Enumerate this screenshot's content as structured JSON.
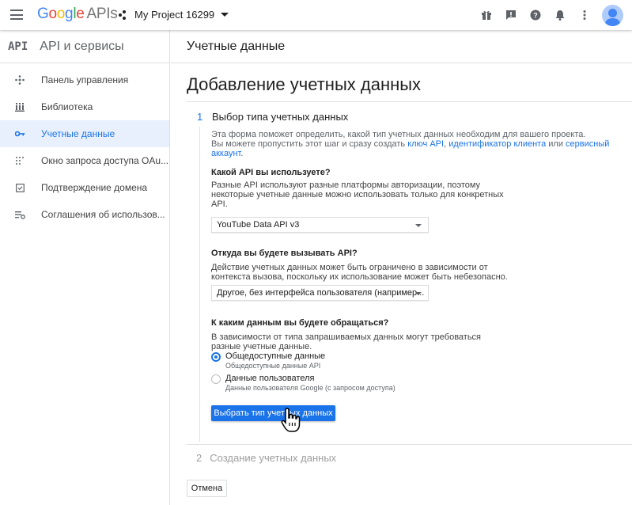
{
  "topbar": {
    "logo_google": [
      "G",
      "o",
      "o",
      "g",
      "l",
      "e"
    ],
    "logo_apis": "APIs",
    "project_name": "My Project 16299",
    "icons": [
      "gift-icon",
      "feedback-icon",
      "help-icon",
      "notifications-icon",
      "more-vert-icon"
    ]
  },
  "sidebar": {
    "api_logo": "API",
    "title": "API и сервисы",
    "items": [
      {
        "label": "Панель управления",
        "icon": "dashboard-icon",
        "active": false
      },
      {
        "label": "Библиотека",
        "icon": "library-icon",
        "active": false
      },
      {
        "label": "Учетные данные",
        "icon": "key-icon",
        "active": true
      },
      {
        "label": "Окно запроса доступа OAu...",
        "icon": "oauth-consent-icon",
        "active": false
      },
      {
        "label": "Подтверждение домена",
        "icon": "domain-verification-icon",
        "active": false
      },
      {
        "label": "Соглашения об использов...",
        "icon": "agreements-icon",
        "active": false
      }
    ]
  },
  "header": {
    "title": "Учетные данные"
  },
  "main": {
    "page_title": "Добавление учетных данных",
    "step1": {
      "number": "1",
      "title": "Выбор типа учетных данных",
      "intro_line1": "Эта форма поможет определить, какой тип учетных данных необходим для вашего проекта.",
      "intro_line2_prefix": "Вы можете пропустить этот шаг и сразу создать ",
      "link_api_key": "ключ API",
      "comma": ", ",
      "link_client_id": "идентификатор клиента",
      "or": " или ",
      "link_service_account": "сервисный аккаунт",
      "period": ".",
      "q1_title": "Какой API вы используете?",
      "q1_desc": "Разные API используют разные платформы авторизации, поэтому некоторые учетные данные можно использовать только для конкретных API.",
      "q1_value": "YouTube Data API v3",
      "q2_title": "Откуда вы будете вызывать API?",
      "q2_desc": "Действие учетных данных может быть ограничено в зависимости от контекста вызова, поскольку их использование может быть небезопасно.",
      "q2_value": "Другое, без интерфейса пользователя (например...",
      "q3_title": "К каким данным вы будете обращаться?",
      "q3_desc": "В зависимости от типа запрашиваемых данных могут требоваться разные учетные данные.",
      "radio1_label": "Общедоступные данные",
      "radio1_sub": "Общедоступные данные API",
      "radio1_checked": true,
      "radio2_label": "Данные пользователя",
      "radio2_sub": "Данные пользователя Google (с запросом доступа)",
      "radio2_checked": false,
      "submit_label": "Выбрать тип учетных данных"
    },
    "step2": {
      "number": "2",
      "title": "Создание учетных данных"
    },
    "cancel_label": "Отмена"
  },
  "colors": {
    "accent": "#1a73e8",
    "active_bg": "#e8f0fe",
    "divider": "#e0e0e0"
  }
}
